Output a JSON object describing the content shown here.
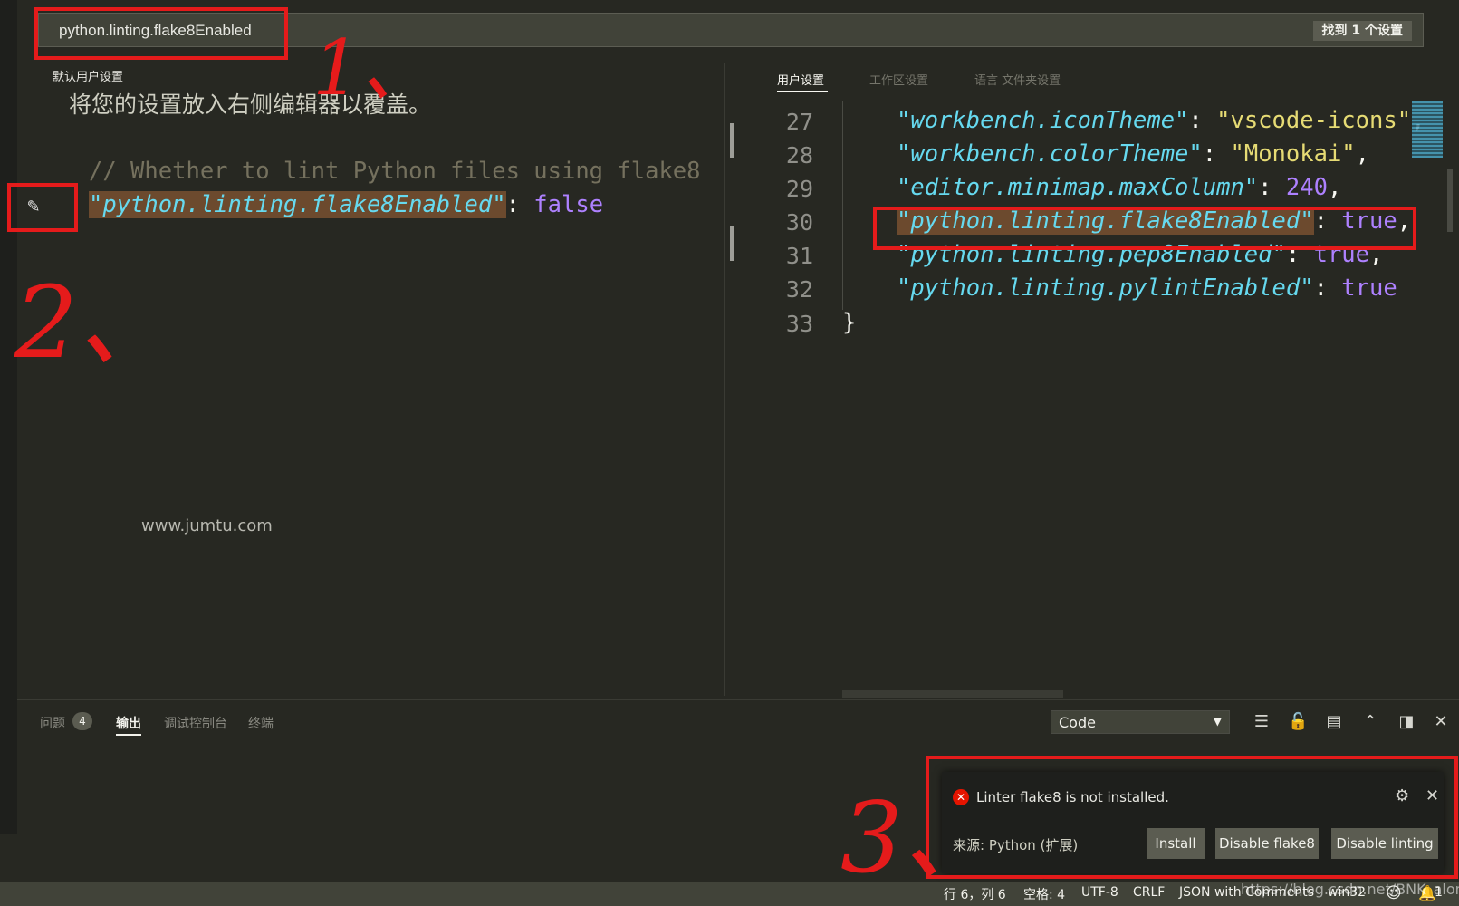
{
  "search": {
    "query": "python.linting.flake8Enabled",
    "result_badge": "找到 1 个设置"
  },
  "left_pane": {
    "title": "默认用户设置",
    "hint": "将您的设置放入右侧编辑器以覆盖。",
    "comment": "// Whether to lint Python files using flake8",
    "setting_key": "\"python.linting.flake8Enabled\"",
    "setting_value": "false",
    "edit_icon": "pencil-icon"
  },
  "right_pane": {
    "tabs": [
      "用户设置",
      "工作区设置",
      "语言 文件夹设置"
    ],
    "lines": [
      {
        "num": "27",
        "key": "\"workbench.iconTheme\"",
        "value": "\"vscode-icons\"",
        "trail": ","
      },
      {
        "num": "28",
        "key": "\"workbench.colorTheme\"",
        "value": "\"Monokai\"",
        "trail": ","
      },
      {
        "num": "29",
        "key": "\"editor.minimap.maxColumn\"",
        "value": "240",
        "trail": ","
      },
      {
        "num": "30",
        "key": "\"python.linting.flake8Enabled\"",
        "value": "true",
        "trail": ","
      },
      {
        "num": "31",
        "key": "\"python.linting.pep8Enabled\"",
        "value": "true",
        "trail": ","
      },
      {
        "num": "32",
        "key": "\"python.linting.pylintEnabled\"",
        "value": "true",
        "trail": ""
      },
      {
        "num": "33",
        "brace": "}"
      }
    ]
  },
  "panel": {
    "tabs": {
      "problems": "问题",
      "problems_count": "4",
      "output": "输出",
      "debug_console": "调试控制台",
      "terminal": "终端"
    },
    "output_channel": "Code",
    "icons": [
      "clear-output-icon",
      "lock-scroll-icon",
      "open-log-icon",
      "maximize-panel-icon",
      "toggle-panel-position-icon",
      "close-panel-icon"
    ]
  },
  "notification": {
    "message": "Linter flake8 is not installed.",
    "source": "来源: Python (扩展)",
    "buttons": {
      "install": "Install",
      "disable_flake8": "Disable flake8",
      "disable_linting": "Disable linting"
    }
  },
  "status_bar": {
    "position": "行 6，列 6",
    "spaces": "空格: 4",
    "encoding": "UTF-8",
    "eol": "CRLF",
    "language": "JSON with Comments",
    "os": "win32",
    "bell_count": "1"
  },
  "watermarks": {
    "site": "www.jumtu.com",
    "blog": "https://blog.csdn.net/BNK_along"
  },
  "annotations": [
    "1、",
    "2、",
    "3、"
  ],
  "colors": {
    "annotation_red": "#e51b1b",
    "background": "#272822",
    "error": "#e51400"
  }
}
